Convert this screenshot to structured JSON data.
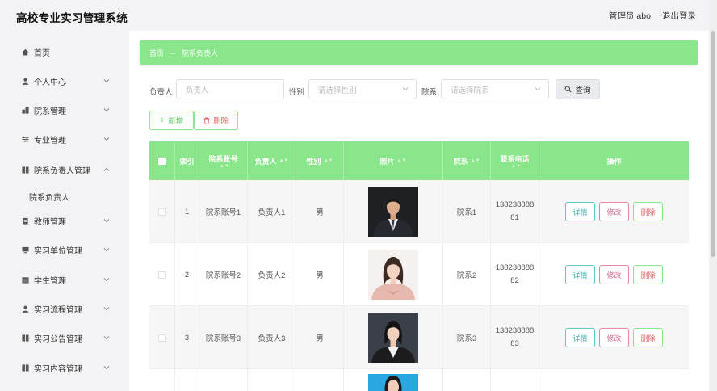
{
  "header": {
    "title": "高校专业实习管理系统",
    "admin_label": "管理员 abo",
    "logout_label": "退出登录"
  },
  "sidebar": {
    "items": [
      {
        "label": "首页",
        "icon": "home-icon"
      },
      {
        "label": "个人中心",
        "icon": "user-icon"
      },
      {
        "label": "院系管理",
        "icon": "building-icon"
      },
      {
        "label": "专业管理",
        "icon": "sliders-icon"
      },
      {
        "label": "院系负责人管理",
        "icon": "grid-icon"
      },
      {
        "label": "教师管理",
        "icon": "clipboard-icon"
      },
      {
        "label": "实习单位管理",
        "icon": "monitor-icon"
      },
      {
        "label": "学生管理",
        "icon": "calendar-icon"
      },
      {
        "label": "实习流程管理",
        "icon": "user-icon"
      },
      {
        "label": "实习公告管理",
        "icon": "grid-icon"
      },
      {
        "label": "实习内容管理",
        "icon": "grid-icon"
      }
    ],
    "submenu_label": "院系负责人"
  },
  "breadcrumb": {
    "home": "首页",
    "arrow": "→",
    "current": "院系负责人"
  },
  "search": {
    "person_label": "负责人",
    "person_placeholder": "负责人",
    "gender_label": "性别",
    "gender_placeholder": "请选择性别",
    "dept_label": "院系",
    "dept_placeholder": "请选择院系",
    "query_label": "查询"
  },
  "toolbar": {
    "add_label": "新增",
    "delete_label": "删除"
  },
  "table": {
    "headers": {
      "index": "索引",
      "account": "院系账号",
      "person": "负责人",
      "gender": "性别",
      "photo": "照片",
      "dept": "院系",
      "phone": "联系电话",
      "ops": "操作"
    },
    "rows": [
      {
        "index": "1",
        "account": "院系账号1",
        "person": "负责人1",
        "gender": "男",
        "dept": "院系1",
        "phone_a": "138238888",
        "phone_b": "81"
      },
      {
        "index": "2",
        "account": "院系账号2",
        "person": "负责人2",
        "gender": "男",
        "dept": "院系2",
        "phone_a": "138238888",
        "phone_b": "82"
      },
      {
        "index": "3",
        "account": "院系账号3",
        "person": "负责人3",
        "gender": "男",
        "dept": "院系3",
        "phone_a": "138238888",
        "phone_b": "83"
      }
    ],
    "actions": {
      "detail": "详情",
      "edit": "修改",
      "remove": "删除"
    }
  },
  "colors": {
    "accent": "#8ae68a",
    "danger": "#e06060",
    "info": "#3bb3b3",
    "edit": "#d86a8e"
  }
}
